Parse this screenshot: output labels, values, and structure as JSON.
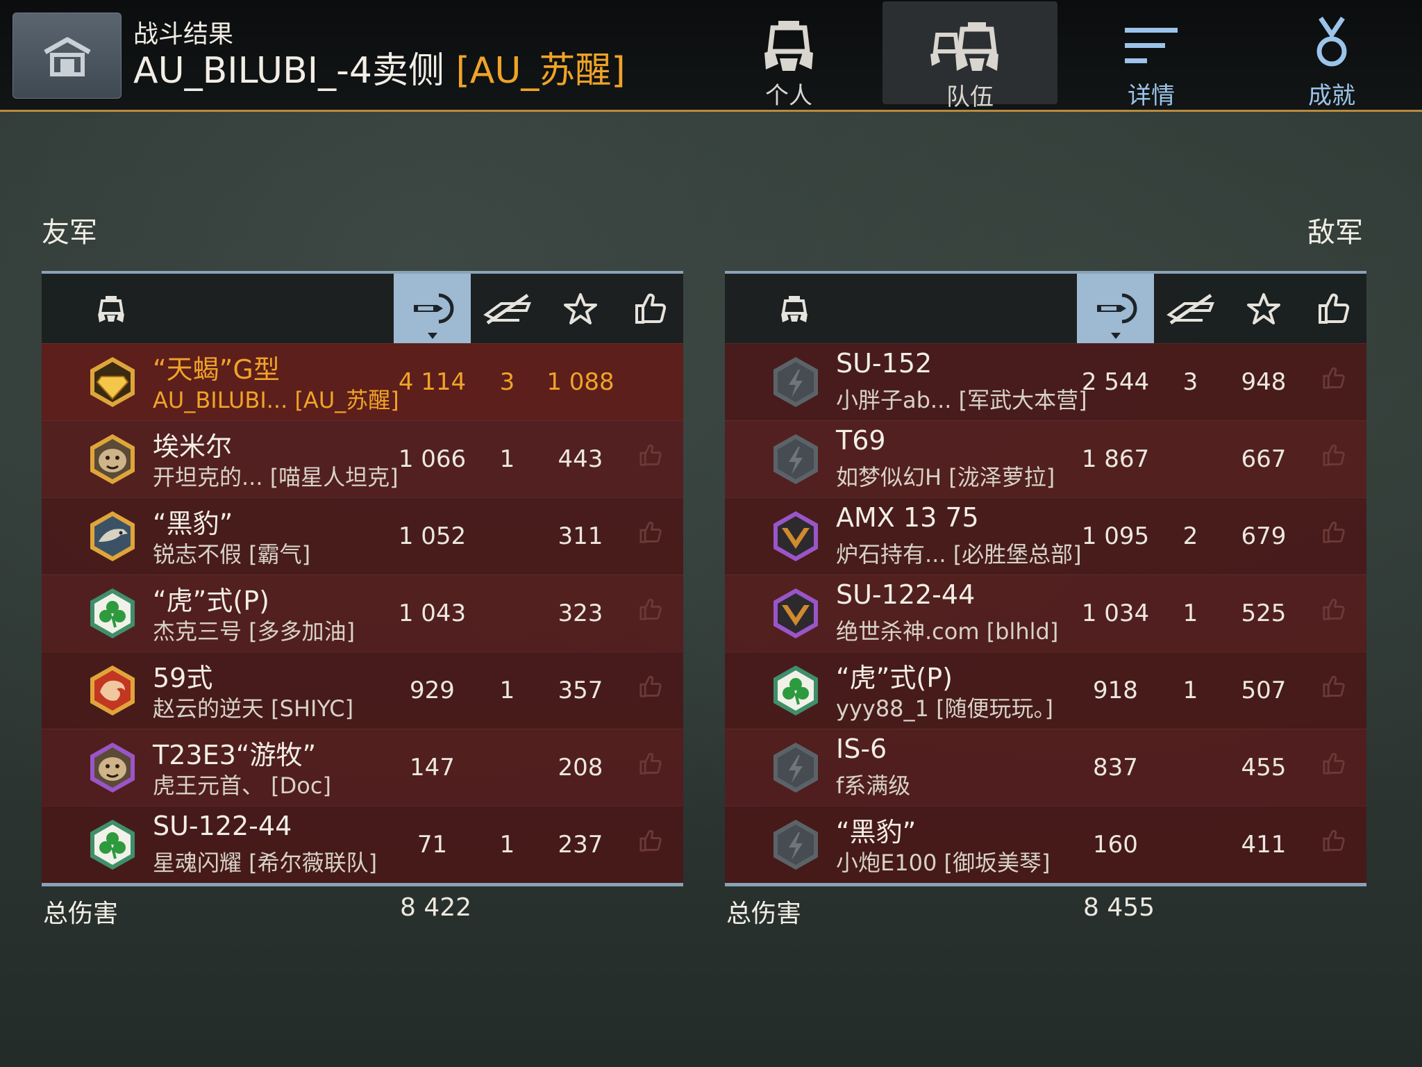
{
  "header": {
    "subtitle": "战斗结果",
    "map_name": "AU_BILUBI_-4卖侧",
    "clan": "[AU_苏醒]"
  },
  "tabs": [
    {
      "label": "个人",
      "icon": "tank-commander-icon",
      "active": false
    },
    {
      "label": "队伍",
      "icon": "team-icon",
      "active": true
    },
    {
      "label": "详情",
      "icon": "details-lines-icon",
      "active": false
    },
    {
      "label": "成就",
      "icon": "medal-icon",
      "active": false
    }
  ],
  "allies": {
    "label": "友军",
    "total_label": "总伤害",
    "total_damage": "8 422",
    "rows": [
      {
        "tank": "“天蝎”G型",
        "player": "AU_BILUBI... [AU_苏醒]",
        "damage": "4 114",
        "kills": "3",
        "xp": "1 088",
        "badge": "gold-diamond-badge",
        "highlight": true
      },
      {
        "tank": "埃米尔",
        "player": "开坦克的... [喵星人坦克]",
        "damage": "1 066",
        "kills": "1",
        "xp": "443",
        "badge": "gold-tiger-badge"
      },
      {
        "tank": "“黑豹”",
        "player": "锐志不假 [霸气]",
        "damage": "1 052",
        "kills": "",
        "xp": "311",
        "badge": "gold-eagle-badge"
      },
      {
        "tank": "“虎”式(P)",
        "player": "杰克三号 [多多加油]",
        "damage": "1 043",
        "kills": "",
        "xp": "323",
        "badge": "green-clover-badge"
      },
      {
        "tank": "59式",
        "player": "赵云的逆天 [SHIYC]",
        "damage": "929",
        "kills": "1",
        "xp": "357",
        "badge": "red-dragon-badge"
      },
      {
        "tank": "T23E3“游牧”",
        "player": "虎王元首、 [Doc]",
        "damage": "147",
        "kills": "",
        "xp": "208",
        "badge": "purple-tiger-badge"
      },
      {
        "tank": "SU-122-44",
        "player": "星魂闪耀 [希尔薇联队]",
        "damage": "71",
        "kills": "1",
        "xp": "237",
        "badge": "green-clover-badge"
      }
    ]
  },
  "enemies": {
    "label": "敌军",
    "total_label": "总伤害",
    "total_damage": "8 455",
    "rows": [
      {
        "tank": "SU-152",
        "player": "小胖子ab... [军武大本营]",
        "damage": "2 544",
        "kills": "3",
        "xp": "948",
        "badge": "grey-lightning-badge"
      },
      {
        "tank": "T69",
        "player": "如梦似幻H [泷泽萝拉]",
        "damage": "1 867",
        "kills": "",
        "xp": "667",
        "badge": "grey-lightning-badge"
      },
      {
        "tank": "AMX 13 75",
        "player": "炉石持有... [必胜堡总部]",
        "damage": "1 095",
        "kills": "2",
        "xp": "679",
        "badge": "purple-chevron-badge"
      },
      {
        "tank": "SU-122-44",
        "player": "绝世杀神.com [blhld]",
        "damage": "1 034",
        "kills": "1",
        "xp": "525",
        "badge": "purple-chevron-badge"
      },
      {
        "tank": "“虎”式(P)",
        "player": "yyy88_1 [随便玩玩。]",
        "damage": "918",
        "kills": "1",
        "xp": "507",
        "badge": "green-clover-badge"
      },
      {
        "tank": "IS-6",
        "player": "f系满级",
        "damage": "837",
        "kills": "",
        "xp": "455",
        "badge": "grey-lightning-badge"
      },
      {
        "tank": "“黑豹”",
        "player": "小炮E100 [御坂美琴]",
        "damage": "160",
        "kills": "",
        "xp": "411",
        "badge": "grey-lightning-badge"
      }
    ]
  },
  "columns": {
    "player_icon": "tank-helmet-icon",
    "damage_icon": "damage-shell-icon",
    "kills_icon": "destroyed-icon",
    "xp_icon": "star-icon",
    "like_icon": "thumbs-up-icon",
    "sorted_by": "damage"
  },
  "colors": {
    "accent": "#f0a328",
    "header_strip": "#8ba3b8",
    "sorted_column": "#9eb9d2",
    "row_bg": "#4a1616"
  }
}
